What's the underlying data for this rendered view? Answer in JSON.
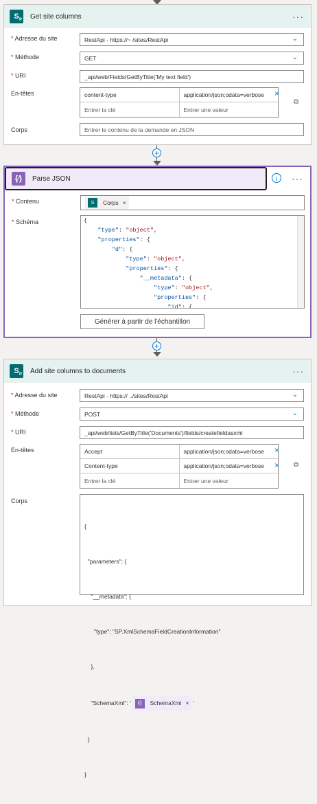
{
  "card1": {
    "title": "Get site columns",
    "more": "···",
    "site_label": "Adresse du site",
    "site_value": "RestApi - https://~                              /sites/RestApi",
    "method_label": "Méthode",
    "method_value": "GET",
    "uri_label": "URI",
    "uri_value": "_api/web/Fields/GetByTitle('My text field')",
    "headers_label": "En-têtes",
    "headers": [
      {
        "key": "content-type",
        "value": "application/json;odata=verbose"
      },
      {
        "key": "Entrer la clé",
        "value": "Entrer une valeur"
      }
    ],
    "body_label": "Corps",
    "body_placeholder": "Entrer le contenu de la demande en JSON"
  },
  "card2": {
    "title": "Parse JSON",
    "more": "···",
    "content_label": "Contenu",
    "content_token": "Corps",
    "schema_label": "Schéma",
    "schema_lines": [
      "{",
      "    \"type\": \"object\",",
      "    \"properties\": {",
      "        \"d\": {",
      "            \"type\": \"object\",",
      "            \"properties\": {",
      "                \"__metadata\": {",
      "                    \"type\": \"object\",",
      "                    \"properties\": {",
      "                        \"id\": {"
    ],
    "generate_button": "Générer à partir de l'échantillon"
  },
  "card3": {
    "title": "Add site columns to documents",
    "more": "···",
    "site_label": "Adresse du site",
    "site_value": "RestApi - https://                                   ../sites/RestApi",
    "method_label": "Méthode",
    "method_value": "POST",
    "uri_label": "URI",
    "uri_value": "_api/web/lists/GetByTitle('Documents')/fields/createfieldasxml",
    "headers_label": "En-têtes",
    "headers": [
      {
        "key": "Accept",
        "value": "application/json;odata=verbose"
      },
      {
        "key": "Content-type",
        "value": "application/json;odata=verbose"
      },
      {
        "key": "Entrer la clé",
        "value": "Entrer une valeur"
      }
    ],
    "body_label": "Corps",
    "body_lines": [
      "{",
      "  \"parameters\": {",
      "    \"__metadata\": {",
      "      \"type\": \"SP.XmlSchemaFieldCreationInformation\"",
      "    },",
      "    \"SchemaXml\": '",
      "  }",
      "}"
    ],
    "body_token": "SchemaXml"
  },
  "colors": {
    "accent": "#0078d4",
    "sp_teal": "#036c70",
    "parse_purple": "#8764b8",
    "header_teal": "#e6f2f0",
    "header_purple": "#f1ebf9"
  }
}
